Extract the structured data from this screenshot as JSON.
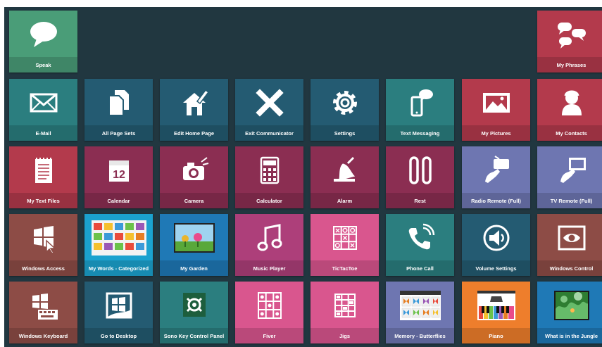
{
  "colors": {
    "background": "#213740",
    "green": "#4a9d78",
    "red": "#b33a4c",
    "teal": "#2b7e7f",
    "navy": "#245b72",
    "maroon": "#8b2e52",
    "magenta": "#ad3f7a",
    "periwinkle": "#6e76b1",
    "brown": "#8d4c46",
    "cyan": "#1ba2cf",
    "orange": "#ee7e2c",
    "pink": "#d9568e",
    "blue": "#1f79b6"
  },
  "tiles": {
    "speak": {
      "label": "Speak",
      "icon": "speech-bubble-icon"
    },
    "my_phrases": {
      "label": "My Phrases",
      "icon": "conversation-icon"
    },
    "email": {
      "label": "E-Mail",
      "icon": "envelope-icon"
    },
    "all_page_sets": {
      "label": "All Page Sets",
      "icon": "documents-icon"
    },
    "edit_home_page": {
      "label": "Edit Home Page",
      "icon": "house-pencil-icon"
    },
    "exit_communicator": {
      "label": "Exit Communicator",
      "icon": "close-x-icon"
    },
    "settings": {
      "label": "Settings",
      "icon": "gear-icon"
    },
    "text_messaging": {
      "label": "Text Messaging",
      "icon": "phone-message-icon"
    },
    "my_pictures": {
      "label": "My Pictures",
      "icon": "picture-frame-icon"
    },
    "my_contacts": {
      "label": "My Contacts",
      "icon": "person-silhouette-icon"
    },
    "my_text_files": {
      "label": "My Text Files",
      "icon": "notepad-icon"
    },
    "calendar": {
      "label": "Calendar",
      "icon": "calendar-icon",
      "day": "12"
    },
    "camera": {
      "label": "Camera",
      "icon": "camera-icon"
    },
    "calculator": {
      "label": "Calculator",
      "icon": "calculator-icon"
    },
    "alarm": {
      "label": "Alarm",
      "icon": "bell-icon"
    },
    "rest": {
      "label": "Rest",
      "icon": "pause-icon"
    },
    "radio_remote": {
      "label": "Radio Remote (Full)",
      "icon": "radio-remote-icon"
    },
    "tv_remote": {
      "label": "TV Remote (Full)",
      "icon": "tv-remote-icon"
    },
    "windows_access": {
      "label": "Windows Access",
      "icon": "windows-cursor-icon"
    },
    "my_words": {
      "label": "My Words - Categorized",
      "icon": "word-grid-thumbnail-icon"
    },
    "my_garden": {
      "label": "My Garden",
      "icon": "garden-thumbnail-icon"
    },
    "music_player": {
      "label": "Music Player",
      "icon": "music-note-icon"
    },
    "tictactoe": {
      "label": "TicTacToe",
      "icon": "tictactoe-icon"
    },
    "phone_call": {
      "label": "Phone Call",
      "icon": "phone-ringing-icon"
    },
    "volume_settings": {
      "label": "Volume Settings",
      "icon": "speaker-icon"
    },
    "windows_control": {
      "label": "Windows Control",
      "icon": "eye-window-icon"
    },
    "windows_keyboard": {
      "label": "Windows Keyboard",
      "icon": "keyboard-icon"
    },
    "go_to_desktop": {
      "label": "Go to Desktop",
      "icon": "desktop-icon"
    },
    "sono_key": {
      "label": "Sono Key Control Panel",
      "icon": "sono-key-icon"
    },
    "fiver": {
      "label": "Fiver",
      "icon": "fiver-grid-icon"
    },
    "jigs": {
      "label": "Jigs",
      "icon": "jigs-grid-icon"
    },
    "memory_butterflies": {
      "label": "Memory - Butterflies",
      "icon": "butterflies-thumbnail-icon"
    },
    "piano": {
      "label": "Piano",
      "icon": "piano-thumbnail-icon"
    },
    "jungle": {
      "label": "What is in the Jungle",
      "icon": "jungle-thumbnail-icon"
    }
  }
}
